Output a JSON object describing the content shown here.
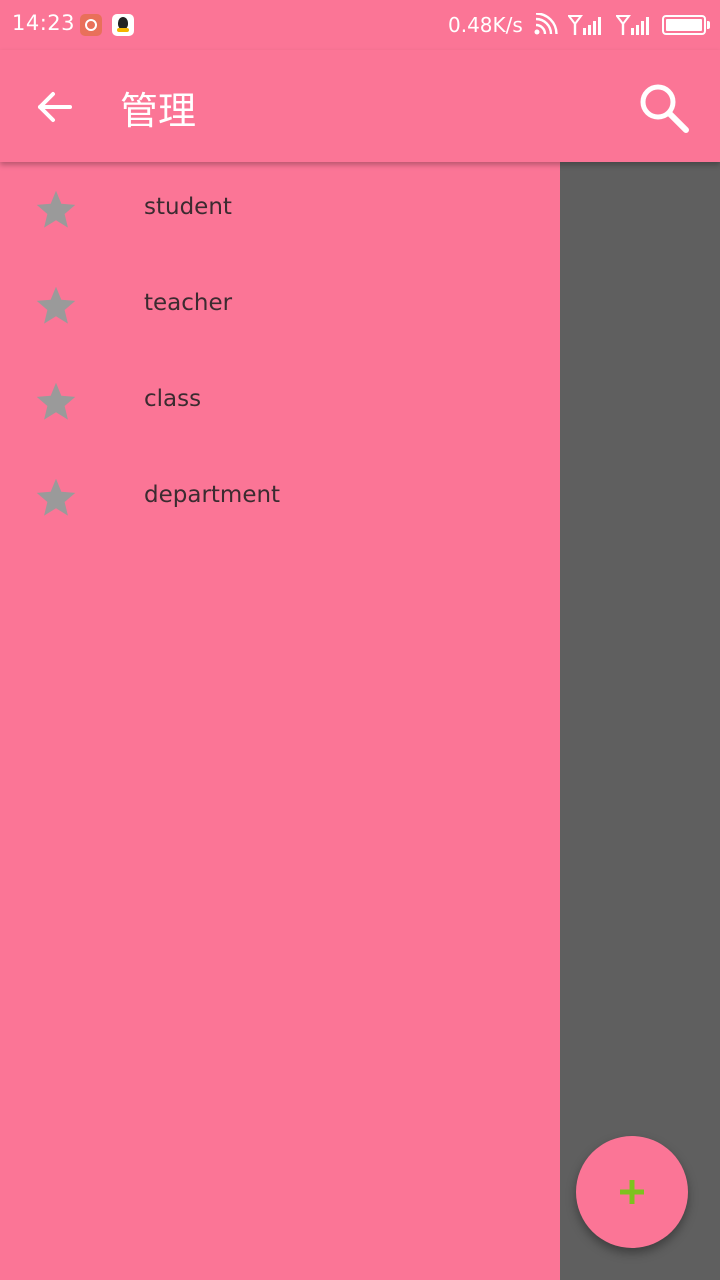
{
  "status_bar": {
    "time": "14:23",
    "network_speed": "0.48K/s",
    "icons": [
      "netease-music-icon",
      "qq-icon",
      "wifi-icon",
      "signal-icon",
      "signal-icon",
      "battery-icon"
    ]
  },
  "app_bar": {
    "title": "管理",
    "back_icon": "arrow-left-icon",
    "search_icon": "search-icon"
  },
  "drawer": {
    "items": [
      {
        "label": "student",
        "icon": "star-icon"
      },
      {
        "label": "teacher",
        "icon": "star-icon"
      },
      {
        "label": "class",
        "icon": "star-icon"
      },
      {
        "label": "department",
        "icon": "star-icon"
      }
    ]
  },
  "fab": {
    "icon": "plus-icon",
    "icon_color": "#7dc21e"
  },
  "colors": {
    "primary": "#fb7596",
    "scrim": "#5f5f5f",
    "star": "#9a9a9a",
    "text": "#3b2b30"
  }
}
